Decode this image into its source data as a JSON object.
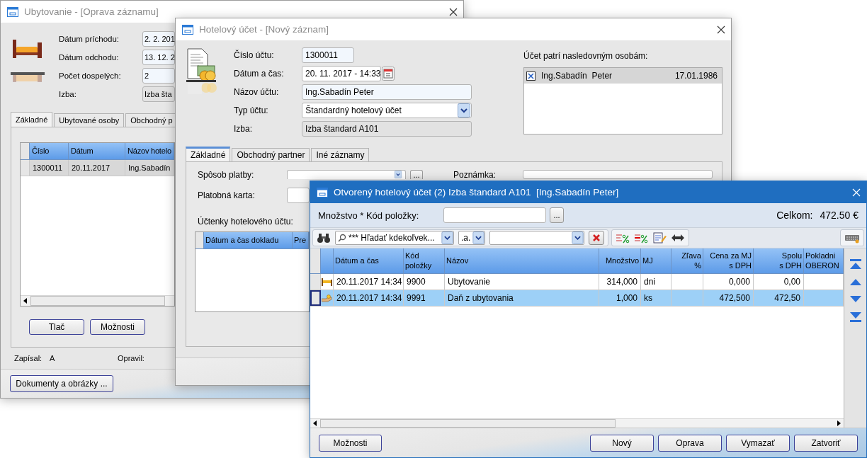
{
  "accommodation_window": {
    "title": "Ubytovanie - [Oprava záznamu]",
    "fields": [
      {
        "label": "Dátum príchodu:",
        "value": "2. 2. 201",
        "kind": "text"
      },
      {
        "label": "Dátum odchodu:",
        "value": "13. 12. 2",
        "kind": "text"
      },
      {
        "label": "Počet dospelých:",
        "value": "2",
        "kind": "text"
      },
      {
        "label": "Izba:",
        "value": "Izba šta",
        "kind": "readonly"
      }
    ],
    "tabs": [
      {
        "label": "Základné",
        "selected": true
      },
      {
        "label": "Ubytované osoby",
        "selected": false
      },
      {
        "label": "Obchodný p",
        "selected": false
      }
    ],
    "table": {
      "columns": [
        "Číslo",
        "Dátum",
        "Názov hotelo"
      ],
      "rows": [
        {
          "cells": [
            "1300011",
            "20.11.2017",
            "Ing.Sabadín"
          ],
          "selected": true
        }
      ]
    },
    "buttons": [
      "Tlač",
      "Možnosti"
    ],
    "created_label": "Zapísal:",
    "created_value": "A",
    "modified_label": "Opravil:",
    "documents_button": "Dokumenty a obrázky ..."
  },
  "account_window": {
    "title": "Hotelový účet - [Nový záznam]",
    "fields": [
      {
        "label": "Číslo účtu:",
        "value": "1300011",
        "kind": "text"
      },
      {
        "label": "Dátum a čas:",
        "value": "20. 11. 2017 - 14:33",
        "kind": "date"
      },
      {
        "label": "Názov účtu:",
        "value": "Ing.Sabadín Peter",
        "kind": "text"
      },
      {
        "label": "Typ účtu:",
        "value": "Štandardný hotelový účet",
        "kind": "select"
      },
      {
        "label": "Izba:",
        "value": "Izba štandard A101",
        "kind": "readonly"
      }
    ],
    "persons_label": "Účet patrí nasledovným osobám:",
    "persons": [
      {
        "name": "Ing.Sabadín  Peter",
        "date": "17.01.1986",
        "checked": true,
        "selected": true
      }
    ],
    "tabs": [
      {
        "label": "Základné",
        "selected": true
      },
      {
        "label": "Obchodný partner",
        "selected": false
      },
      {
        "label": "Iné záznamy",
        "selected": false
      }
    ],
    "payment_label": "Spôsob platby:",
    "more_button": "...",
    "note_label": "Poznámka:",
    "card_label": "Platobná karta:",
    "receipts_label": "Účtenky hotelového účtu:",
    "receipt_columns": [
      "Dátum a čas dokladu",
      "Pre"
    ]
  },
  "open_account_window": {
    "title": "Otvorený hotelový účet (2) Izba štandard A101  [Ing.Sabadín Peter]",
    "quantity_label": "Množstvo * Kód položky:",
    "more_button": "...",
    "total_label": "Celkom:",
    "total_value": "472.50 €",
    "search_scope": "*** Hľadať kdekoľvek...",
    "search_mode": ".a.",
    "columns": [
      {
        "label": "Dátum a čas",
        "kind": "text"
      },
      {
        "label": "Kód\npoložky",
        "kind": "text"
      },
      {
        "label": "Názov",
        "kind": "text"
      },
      {
        "label": "Množstvo",
        "kind": "number"
      },
      {
        "label": "MJ",
        "kind": "text"
      },
      {
        "label": "Zľava\n%",
        "kind": "number"
      },
      {
        "label": "Cena za MJ\ns DPH",
        "kind": "number"
      },
      {
        "label": "Spolu\ns DPH",
        "kind": "number"
      },
      {
        "label": "Pokladni\nOBERON",
        "kind": "text"
      }
    ],
    "rows": [
      {
        "kind": "stay",
        "selected": false,
        "date": "20.11.2017 14:34",
        "code": "9900",
        "name": "Ubytovanie",
        "quantity": "314,000",
        "unit": "dni",
        "price": "0,000",
        "total": "0,00"
      },
      {
        "kind": "fee",
        "selected": true,
        "date": "20.11.2017 14:34",
        "code": "9991",
        "name": "Daň z ubytovania",
        "quantity": "1,000",
        "unit": "ks",
        "price": "472,500",
        "total": "472,50"
      }
    ],
    "buttons_left": [
      "Možnosti"
    ],
    "buttons_right": [
      "Nový",
      "Oprava",
      "Vymazať",
      "Zatvoriť"
    ]
  }
}
